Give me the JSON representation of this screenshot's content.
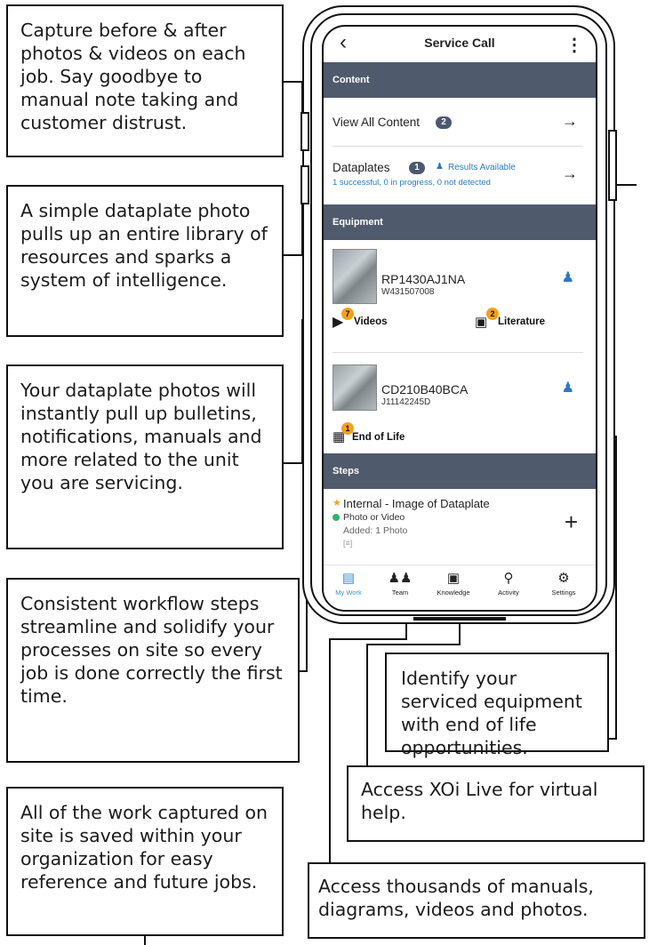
{
  "callouts": {
    "capture": "Capture before & after photos & videos on each job. Say goodbye to manual note taking and customer distrust.",
    "dataplate": "A simple dataplate photo pulls up an entire library of resources and sparks a system of intelligence.",
    "bulletins": "Your dataplate photos will instantly pull up bulletins, notifications, manuals and more related to the unit you are servicing.",
    "workflow": "Consistent workflow steps streamline and solidify your processes on site so every job is done correctly the first time.",
    "saved": "All of the work captured on site is saved within your organization for easy reference and future jobs.",
    "end_of_life": "Identify your serviced equipment with end of life opportunities.",
    "xoi_live": "Access XOi Live for virtual help.",
    "manuals": "Access thousands of manuals, diagrams, videos and photos."
  },
  "app": {
    "back_icon": "back-chevron-icon",
    "title": "Service Call",
    "menu_icon": "kebab-menu-icon",
    "content_section": "Content",
    "view_all_content": "View All Content",
    "view_all_badge": "2",
    "dataplates_label": "Dataplates",
    "dataplates_badge": "1",
    "results_available": "Results Available",
    "dataplates_status": "1 successful, 0 in progress, 0 not detected",
    "arrow": "→",
    "equipment_section": "Equipment",
    "equipment": [
      {
        "model": "RP1430AJ1NA",
        "serial": "W431507008"
      },
      {
        "model": "CD210B40BCA",
        "serial": "J11142245D"
      }
    ],
    "videos_label": "Videos",
    "videos_badge": "7",
    "literature_label": "Literature",
    "literature_badge": "2",
    "end_of_life_label": "End of Life",
    "end_of_life_badge": "1",
    "steps_section": "Steps",
    "step_title": "Internal - Image of Dataplate",
    "step_type": "Photo or Video",
    "step_added": "Added: 1 Photo",
    "add_icon": "+",
    "nav": [
      {
        "label": "My Work",
        "icon": "clipboard-icon"
      },
      {
        "label": "Team",
        "icon": "team-icon"
      },
      {
        "label": "Knowledge",
        "icon": "book-icon"
      },
      {
        "label": "Activity",
        "icon": "search-icon"
      },
      {
        "label": "Settings",
        "icon": "gear-icon"
      }
    ]
  },
  "colors": {
    "section_header": "#4f5a6c",
    "badge_dark": "#4d5870",
    "badge_orange": "#f2a21b",
    "accent_blue": "#2b7bbf",
    "active_nav": "#3a8fd0"
  }
}
